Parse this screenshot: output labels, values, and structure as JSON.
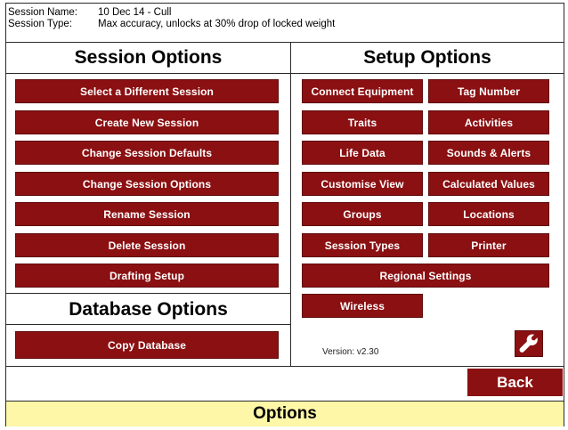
{
  "session": {
    "name_label": "Session Name:",
    "name_value": "10 Dec 14 - Cull",
    "type_label": "Session Type:",
    "type_value": "Max accuracy, unlocks at 30% drop of locked weight"
  },
  "session_options": {
    "title": "Session Options",
    "buttons": [
      "Select a Different Session",
      "Create New Session",
      "Change Session Defaults",
      "Change Session Options",
      "Rename Session",
      "Delete Session",
      "Drafting Setup"
    ]
  },
  "database_options": {
    "title": "Database Options",
    "buttons": [
      "Copy Database"
    ]
  },
  "setup_options": {
    "title": "Setup Options",
    "buttons": [
      "Connect Equipment",
      "Tag Number",
      "Traits",
      "Activities",
      "Life Data",
      "Sounds & Alerts",
      "Customise View",
      "Calculated Values",
      "Groups",
      "Locations",
      "Session Types",
      "Printer",
      "Regional Settings",
      "Wireless"
    ]
  },
  "version": "Version: v2.30",
  "back_label": "Back",
  "footer_title": "Options",
  "colors": {
    "button": "#8b1012",
    "footer": "#fff7a8"
  },
  "icons": {
    "settings": "wrench-icon"
  }
}
